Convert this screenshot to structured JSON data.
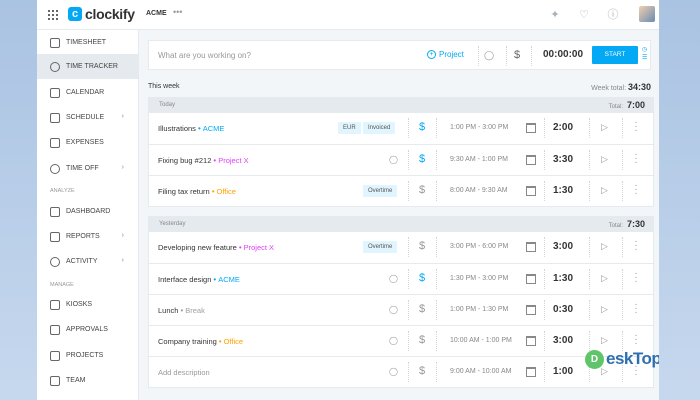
{
  "app": {
    "logo": "clockify",
    "workspace": "ACME",
    "workspace_more": "•••"
  },
  "colors": {
    "accent": "#03a9f4",
    "project_blue": "#03a9f4",
    "project_purple": "#e040fb",
    "project_orange": "#ffa000",
    "project_grey": "#9e9e9e"
  },
  "sidebar": {
    "items": [
      {
        "label": "TIMESHEET",
        "icon": "timesheet-icon"
      },
      {
        "label": "TIME TRACKER",
        "icon": "clock-icon",
        "active": true
      },
      {
        "label": "CALENDAR",
        "icon": "calendar-icon"
      },
      {
        "label": "SCHEDULE",
        "icon": "schedule-icon",
        "chevron": true
      },
      {
        "label": "EXPENSES",
        "icon": "receipt-icon"
      },
      {
        "label": "TIME OFF",
        "icon": "time-off-icon",
        "chevron": true
      }
    ],
    "section_analyze": "ANALYZE",
    "analyze_items": [
      {
        "label": "DASHBOARD",
        "icon": "dashboard-icon"
      },
      {
        "label": "REPORTS",
        "icon": "reports-icon",
        "chevron": true
      },
      {
        "label": "ACTIVITY",
        "icon": "activity-icon",
        "chevron": true
      }
    ],
    "section_manage": "MANAGE",
    "manage_items": [
      {
        "label": "KIOSKS",
        "icon": "kiosk-icon"
      },
      {
        "label": "APPROVALS",
        "icon": "approvals-icon"
      },
      {
        "label": "PROJECTS",
        "icon": "projects-icon"
      },
      {
        "label": "TEAM",
        "icon": "team-icon"
      }
    ]
  },
  "tracker": {
    "placeholder": "What are you working on?",
    "project_label": "Project",
    "timer": "00:00:00",
    "start_label": "START"
  },
  "week": {
    "label": "This week",
    "total_label": "Week total:",
    "total": "34:30"
  },
  "groups": [
    {
      "day": "Today",
      "total_label": "Total:",
      "total": "7:00",
      "entries": [
        {
          "desc": "Illustrations",
          "project": "ACME",
          "project_color": "#03a9f4",
          "badges": [
            "EUR",
            "Invoiced"
          ],
          "billable": true,
          "range": "1:00 PM - 3:00 PM",
          "duration": "2:00"
        },
        {
          "desc": "Fixing bug #212",
          "project": "Project X",
          "project_color": "#e040fb",
          "badges": [],
          "billable": true,
          "range": "9:30 AM - 1:00 PM",
          "duration": "3:30"
        },
        {
          "desc": "Filing tax return",
          "project": "Office",
          "project_color": "#ffa000",
          "badges": [
            "Overtime"
          ],
          "billable": false,
          "range": "8:00 AM - 9:30 AM",
          "duration": "1:30"
        }
      ]
    },
    {
      "day": "Yesterday",
      "total_label": "Total:",
      "total": "7:30",
      "entries": [
        {
          "desc": "Developing new feature",
          "project": "Project X",
          "project_color": "#e040fb",
          "badges": [
            "Overtime"
          ],
          "billable": false,
          "range": "3:00 PM - 6:00 PM",
          "duration": "3:00"
        },
        {
          "desc": "Interface design",
          "project": "ACME",
          "project_color": "#03a9f4",
          "badges": [],
          "billable": true,
          "range": "1:30 PM - 3:00 PM",
          "duration": "1:30"
        },
        {
          "desc": "Lunch",
          "project": "Break",
          "project_color": "#9e9e9e",
          "badges": [],
          "billable": false,
          "range": "1:00 PM - 1:30 PM",
          "duration": "0:30"
        },
        {
          "desc": "Company training",
          "project": "Office",
          "project_color": "#ffa000",
          "badges": [],
          "billable": false,
          "range": "10:00 AM - 1:00 PM",
          "duration": "3:00"
        },
        {
          "desc": "",
          "placeholder": "Add description",
          "project": "",
          "project_color": "",
          "badges": [],
          "billable": false,
          "range": "9:00 AM - 10:00 AM",
          "duration": "1:00"
        }
      ]
    }
  ],
  "watermark": {
    "mark": "D",
    "text": "eskTop"
  }
}
